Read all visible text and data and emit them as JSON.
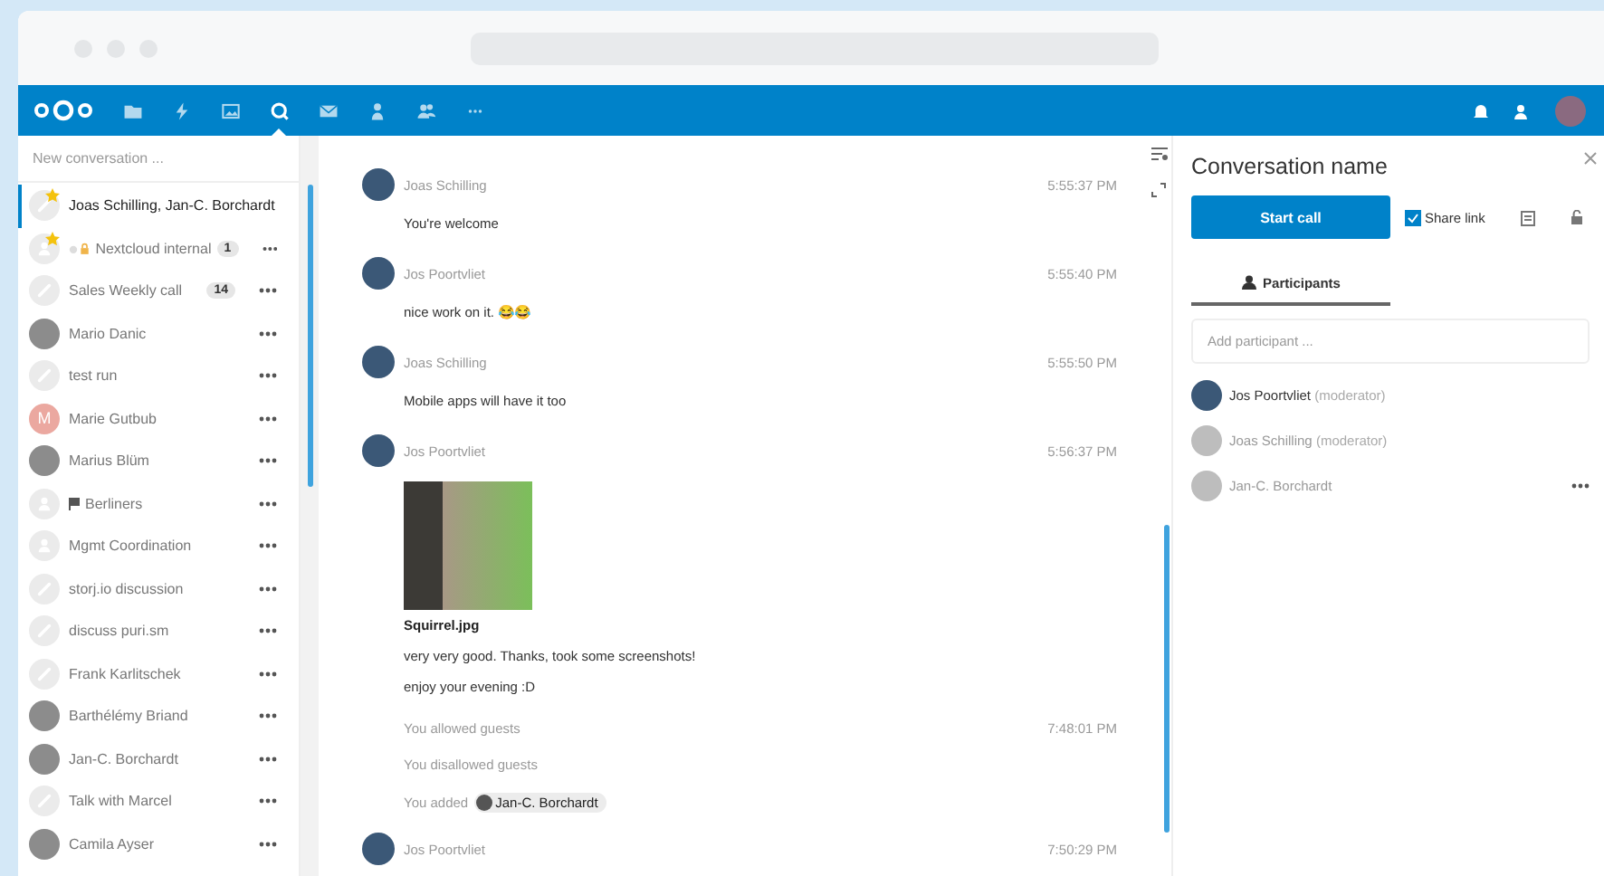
{
  "nav": {
    "apps": [
      {
        "selected": false
      },
      {
        "selected": false
      },
      {
        "selected": false
      },
      {
        "selected": true
      },
      {
        "selected": false
      },
      {
        "selected": false
      },
      {
        "selected": false
      },
      {
        "selected": false
      }
    ]
  },
  "sidebar": {
    "new_conversation": {
      "placeholder": "New conversation ..."
    },
    "conversations": [
      {
        "name": "Joas Schilling, Jan-C. Borchardt",
        "kind": "link",
        "favorite": true,
        "locked": false,
        "flagged": false,
        "selected": true
      },
      {
        "name": "Nextcloud internal",
        "kind": "group",
        "favorite": true,
        "locked": true,
        "flagged": false,
        "unread": "1",
        "selected": false
      },
      {
        "name": "Sales Weekly call",
        "kind": "link",
        "favorite": false,
        "locked": false,
        "flagged": false,
        "unread": "14",
        "selected": false
      },
      {
        "name": "Mario Danic",
        "kind": "photo",
        "favorite": false,
        "locked": false,
        "flagged": false,
        "selected": false
      },
      {
        "name": "test run",
        "kind": "link",
        "favorite": false,
        "locked": false,
        "flagged": false,
        "selected": false
      },
      {
        "name": "Marie Gutbub",
        "kind": "letter",
        "initial": "M",
        "color": "#eba8a0",
        "favorite": false,
        "locked": false,
        "flagged": false,
        "selected": false
      },
      {
        "name": "Marius Blüm",
        "kind": "photo",
        "favorite": false,
        "locked": false,
        "flagged": false,
        "selected": false
      },
      {
        "name": "Berliners",
        "kind": "group",
        "favorite": false,
        "locked": false,
        "flagged": true,
        "selected": false
      },
      {
        "name": "Mgmt Coordination",
        "kind": "group",
        "favorite": false,
        "locked": false,
        "flagged": false,
        "selected": false
      },
      {
        "name": "storj.io discussion",
        "kind": "link",
        "favorite": false,
        "locked": false,
        "flagged": false,
        "selected": false
      },
      {
        "name": "discuss puri.sm",
        "kind": "link",
        "favorite": false,
        "locked": false,
        "flagged": false,
        "selected": false
      },
      {
        "name": "Frank Karlitschek",
        "kind": "link",
        "favorite": false,
        "locked": false,
        "flagged": false,
        "selected": false
      },
      {
        "name": "Barthélémy Briand",
        "kind": "photo",
        "favorite": false,
        "locked": false,
        "flagged": false,
        "selected": false
      },
      {
        "name": "Jan-C. Borchardt",
        "kind": "photo",
        "favorite": false,
        "locked": false,
        "flagged": false,
        "selected": false
      },
      {
        "name": "Talk with Marcel",
        "kind": "link",
        "favorite": false,
        "locked": false,
        "flagged": false,
        "selected": false
      },
      {
        "name": "Camila Ayser",
        "kind": "photo",
        "favorite": false,
        "locked": false,
        "flagged": false,
        "selected": false
      }
    ]
  },
  "chat": {
    "messages": [
      {
        "kind": "message",
        "author": "Joas Schilling",
        "time": "5:55:37 PM",
        "lines": [
          {
            "kind": "text",
            "text": "You're welcome"
          }
        ]
      },
      {
        "kind": "message",
        "author": "Jos Poortvliet",
        "time": "5:55:40 PM",
        "lines": [
          {
            "kind": "text",
            "text": "nice work on it. 😂😂"
          }
        ]
      },
      {
        "kind": "message",
        "author": "Joas Schilling",
        "time": "5:55:50 PM",
        "lines": [
          {
            "kind": "text",
            "text": "Mobile apps will have it too"
          }
        ]
      },
      {
        "kind": "message",
        "author": "Jos Poortvliet",
        "time": "5:56:37 PM",
        "lines": [
          {
            "kind": "file",
            "text": "Squirrel.jpg"
          },
          {
            "kind": "text",
            "text": "very very good. Thanks, took some screenshots!"
          },
          {
            "kind": "text",
            "text": "enjoy your evening :D"
          }
        ]
      },
      {
        "kind": "system",
        "text": "You allowed guests",
        "time": "7:48:01 PM"
      },
      {
        "kind": "system",
        "text": "You disallowed guests"
      },
      {
        "kind": "system",
        "text": "You added",
        "mention": "Jan-C. Borchardt"
      },
      {
        "kind": "message",
        "author": "Jos Poortvliet",
        "time": "7:50:29 PM"
      }
    ]
  },
  "details": {
    "title": "Conversation name",
    "start_call": "Start call",
    "share_link": {
      "label": "Share link",
      "checked": true
    },
    "tabs": [
      {
        "label": "Participants",
        "selected": true
      }
    ],
    "add_participant": {
      "placeholder": "Add participant ..."
    },
    "participants": [
      {
        "name": "Jos Poortvliet",
        "role": "(moderator)",
        "online": true,
        "menu": false
      },
      {
        "name": "Joas Schilling",
        "role": "(moderator)",
        "online": false,
        "menu": false
      },
      {
        "name": "Jan-C. Borchardt",
        "online": false,
        "menu": true
      }
    ]
  }
}
